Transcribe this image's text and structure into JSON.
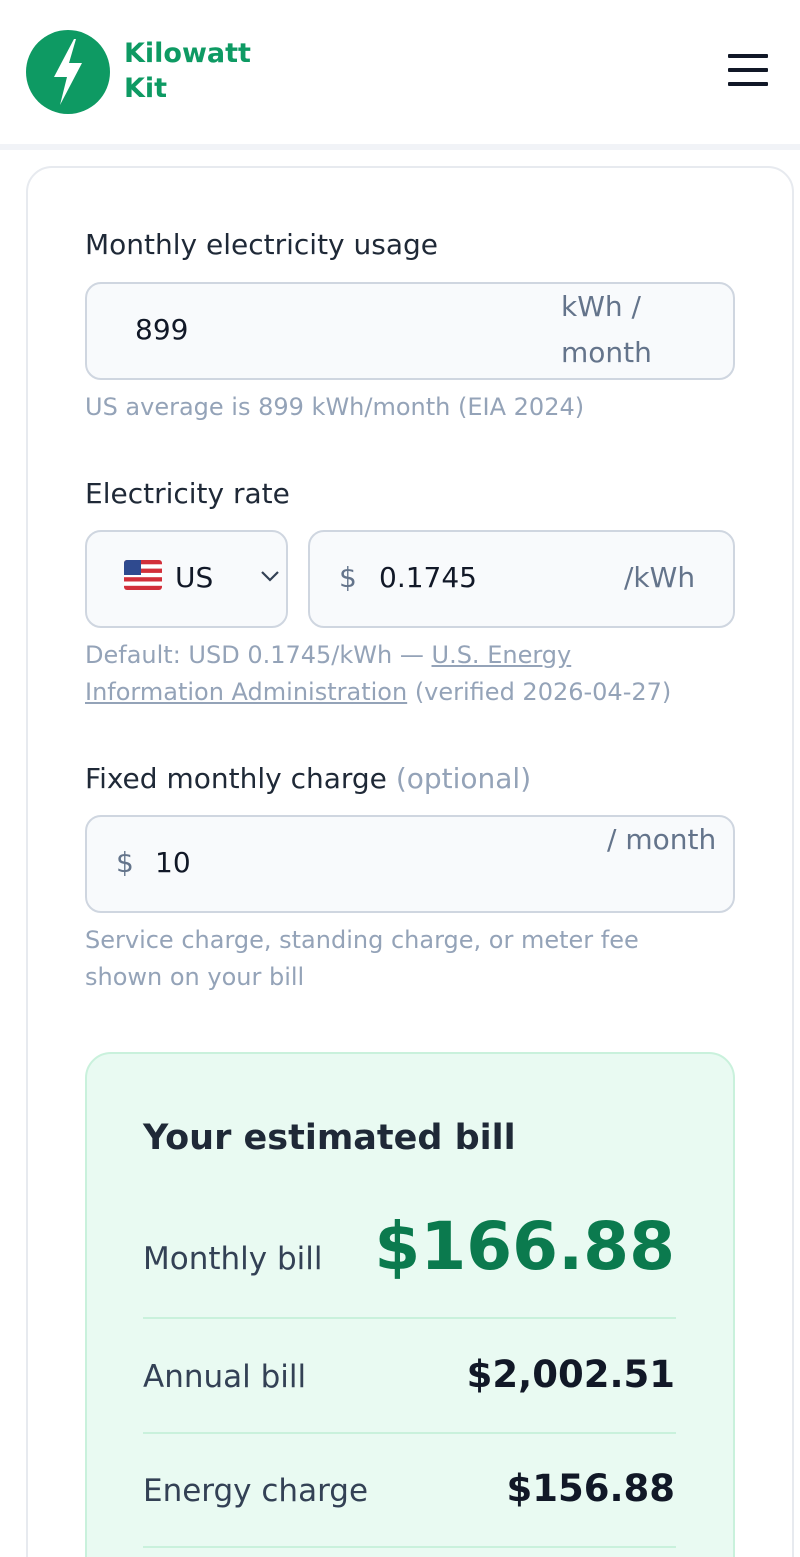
{
  "header": {
    "brand_line1": "Kilowatt",
    "brand_line2": "Kit",
    "brand_color": "#0e9a63",
    "logo_icon": "lightning-bolt-icon",
    "menu_icon": "hamburger-menu-icon"
  },
  "usage": {
    "label": "Monthly electricity usage",
    "value": "899",
    "unit": "kWh / month",
    "hint": "US average is 899 kWh/month (EIA 2024)"
  },
  "rate": {
    "label": "Electricity rate",
    "country_code": "US",
    "flag_icon": "us-flag-icon",
    "currency_symbol": "$",
    "value": "0.1745",
    "unit": "/kWh",
    "hint_prefix": "Default: USD 0.1745/kWh —",
    "source_link_line1": "U.S. Energy",
    "source_link_line2": "Information Administration",
    "hint_suffix": "(verified 2026-04-27)"
  },
  "fixed": {
    "label": "Fixed monthly charge",
    "label_optional": "(optional)",
    "currency_symbol": "$",
    "value": "10",
    "unit": "/ month",
    "hint_line1": "Service charge, standing charge, or meter fee",
    "hint_line2": "shown on your bill"
  },
  "result": {
    "title": "Your estimated bill",
    "monthly_label": "Monthly bill",
    "monthly_value": "$166.88",
    "annual_label": "Annual bill",
    "annual_value": "$2,002.51",
    "energy_label": "Energy charge",
    "energy_value": "$156.88",
    "accent_color": "#0b7a4e"
  }
}
